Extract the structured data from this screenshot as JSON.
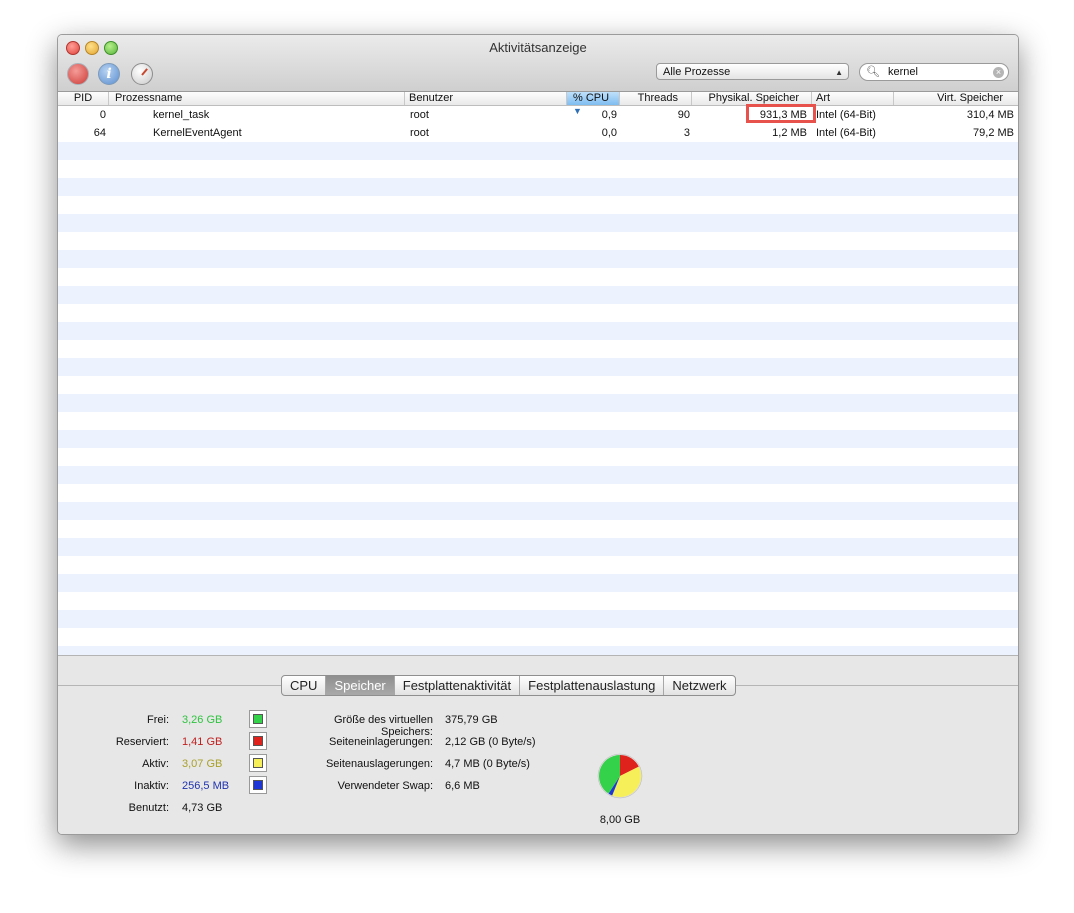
{
  "window": {
    "title": "Aktivitätsanzeige"
  },
  "toolbar": {
    "info_glyph": "i",
    "filter_selected": "Alle Prozesse",
    "search_value": "kernel"
  },
  "table": {
    "headers": {
      "pid": "PID",
      "name": "Prozessname",
      "user": "Benutzer",
      "cpu": "% CPU",
      "threads": "Threads",
      "phys": "Physikal. Speicher",
      "kind": "Art",
      "virt": "Virt. Speicher"
    },
    "rows": [
      {
        "pid": "0",
        "name": "kernel_task",
        "user": "root",
        "cpu": "0,9",
        "threads": "90",
        "phys": "931,3 MB",
        "kind": "Intel (64-Bit)",
        "virt": "310,4 MB"
      },
      {
        "pid": "64",
        "name": "KernelEventAgent",
        "user": "root",
        "cpu": "0,0",
        "threads": "3",
        "phys": "1,2 MB",
        "kind": "Intel (64-Bit)",
        "virt": "79,2 MB"
      }
    ]
  },
  "tabs": [
    "CPU",
    "Speicher",
    "Festplattenaktivität",
    "Festplattenauslastung",
    "Netzwerk"
  ],
  "active_tab": "Speicher",
  "memory": {
    "free": {
      "label": "Frei:",
      "value": "3,26 GB",
      "color": "#2fc33f",
      "swatch": "#34d14a"
    },
    "wired": {
      "label": "Reserviert:",
      "value": "1,41 GB",
      "color": "#c01f1f",
      "swatch": "#e0221c"
    },
    "active": {
      "label": "Aktiv:",
      "value": "3,07 GB",
      "color": "#a9a02a",
      "swatch": "#f7ef5a"
    },
    "inactive": {
      "label": "Inaktiv:",
      "value": "256,5 MB",
      "color": "#2033b0",
      "swatch": "#1f36d6"
    },
    "used": {
      "label": "Benutzt:",
      "value": "4,73 GB"
    }
  },
  "vm": {
    "size_label": "Größe des virtuellen Speichers:",
    "size_value": "375,79 GB",
    "pagein_label": "Seiteneinlagerungen:",
    "pagein_value": "2,12 GB (0 Byte/s)",
    "pageout_label": "Seitenauslagerungen:",
    "pageout_value": "4,7 MB (0 Byte/s)",
    "swap_label": "Verwendeter Swap:",
    "swap_value": "6,6 MB"
  },
  "pie": {
    "total": "8,00 GB"
  }
}
